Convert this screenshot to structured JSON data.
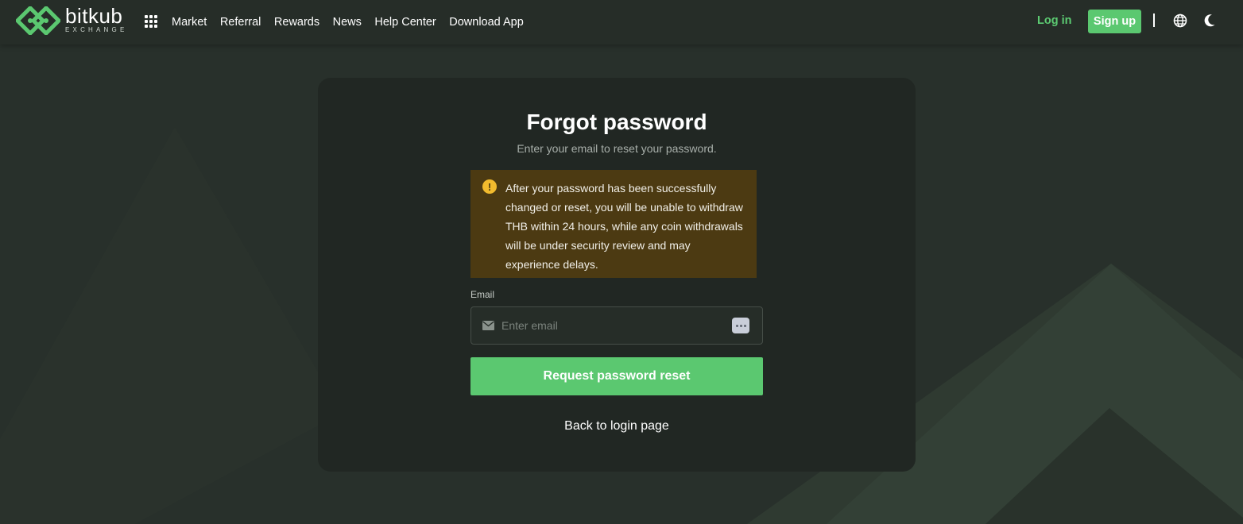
{
  "brand": {
    "name": "bitkub",
    "tagline": "EXCHANGE",
    "logo_icon": "bitkub-diamond-logo",
    "accent_color": "#5bc870"
  },
  "header": {
    "apps_icon": "grid-apps-icon",
    "nav": [
      {
        "label": "Market"
      },
      {
        "label": "Referral"
      },
      {
        "label": "Rewards"
      },
      {
        "label": "News"
      },
      {
        "label": "Help Center"
      },
      {
        "label": "Download App"
      }
    ],
    "login_label": "Log in",
    "signup_label": "Sign up",
    "language_icon": "globe-icon",
    "theme_icon": "moon-icon"
  },
  "form": {
    "title": "Forgot password",
    "subtitle": "Enter your email to reset your password.",
    "warning": {
      "icon": "exclamation-icon",
      "text": "After your password has been successfully changed or reset, you will be unable to withdraw THB within 24 hours, while any coin withdrawals will be under security review and may experience delays.",
      "background": "#4c3a12"
    },
    "email_label": "Email",
    "email_placeholder": "Enter email",
    "email_value": "",
    "submit_label": "Request password reset",
    "back_label": "Back to login page"
  }
}
